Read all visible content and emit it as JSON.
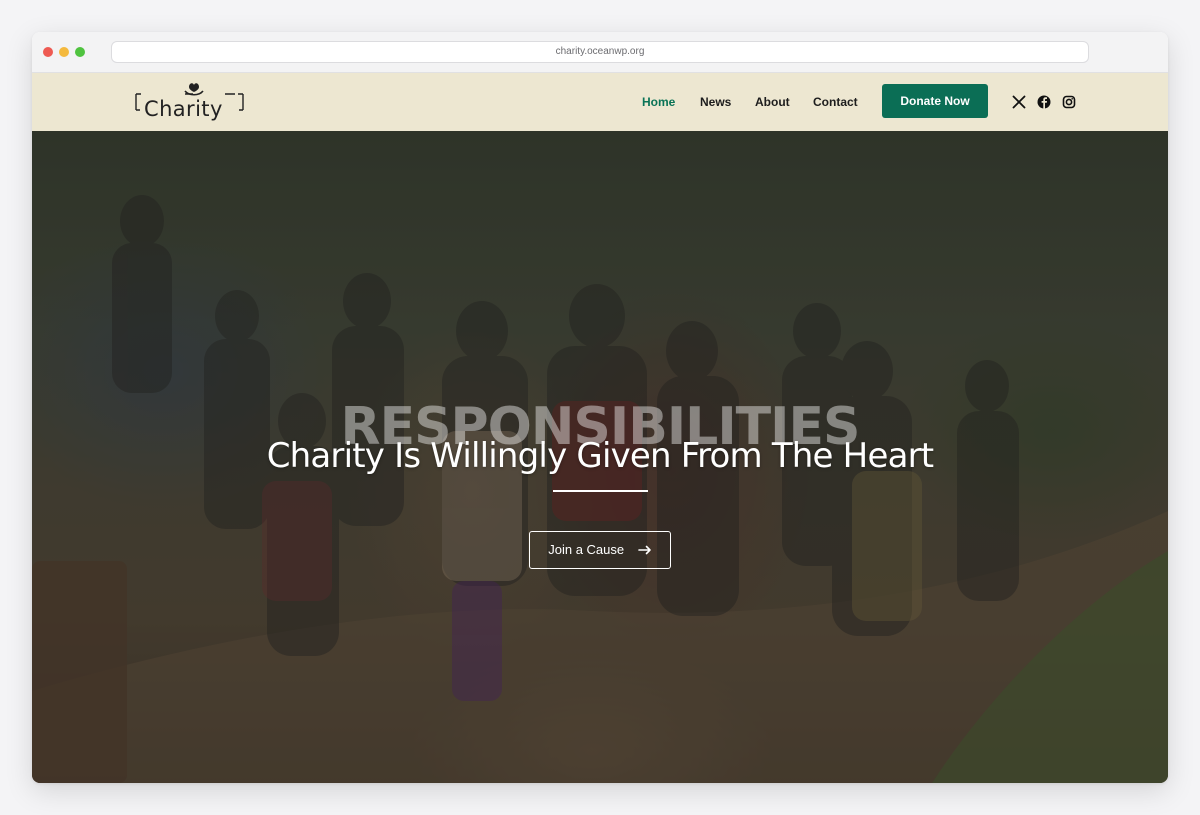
{
  "browser": {
    "url": "charity.oceanwp.org"
  },
  "header": {
    "logo_text": "Charity",
    "nav": [
      "Home",
      "News",
      "About",
      "Contact"
    ],
    "active": "Home",
    "donate_label": "Donate Now",
    "social_icons": [
      "x-icon",
      "facebook-icon",
      "instagram-icon"
    ]
  },
  "hero": {
    "background_word": "RESPONSIBILITIES",
    "title": "Charity Is Willingly Given From The Heart",
    "cta_label": "Join a Cause",
    "cta_icon": "arrow-right-icon"
  },
  "colors": {
    "header_bg": "#ede7d1",
    "accent": "#0b6e55"
  }
}
